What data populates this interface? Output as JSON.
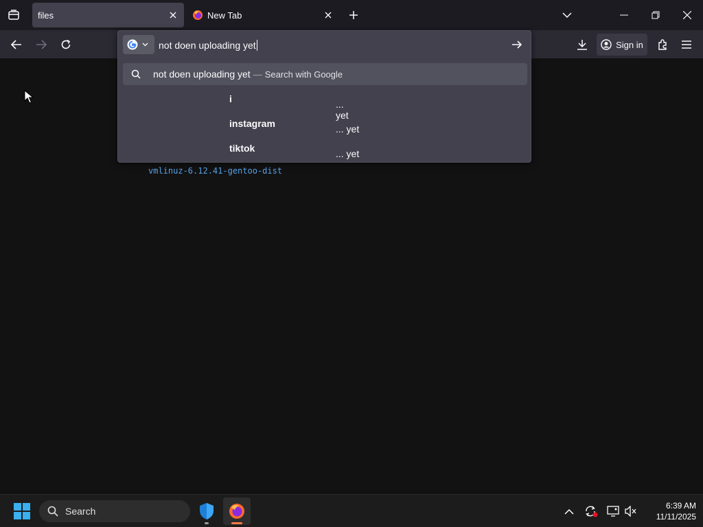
{
  "tabs": [
    {
      "label": "files",
      "active": true
    },
    {
      "label": "New Tab",
      "active": false,
      "icon": "firefox-icon"
    }
  ],
  "urlbar": {
    "value": "not doen uploading yet",
    "engine_icon": "google-icon"
  },
  "suggestions": {
    "main": {
      "query": "not doen uploading yet",
      "separator": "—",
      "engine_text": "Search with Google"
    },
    "items": [
      {
        "prefix": "... yet",
        "suffix": "i"
      },
      {
        "prefix": "... yet ",
        "suffix": "instagram"
      },
      {
        "prefix": "... yet ",
        "suffix": "tiktok"
      }
    ]
  },
  "toolbar": {
    "sign_in_label": "Sign in"
  },
  "page": {
    "link_text": "vmlinuz-6.12.41-gentoo-dist"
  },
  "taskbar": {
    "search_label": "Search",
    "time": "6:39 AM",
    "date": "11/11/2025"
  },
  "colors": {
    "tabbar_bg": "#1c1b22",
    "navbar_bg": "#2b2a33",
    "active_tab_bg": "#42414d",
    "link": "#5aa3e8",
    "page_bg": "#121212"
  }
}
